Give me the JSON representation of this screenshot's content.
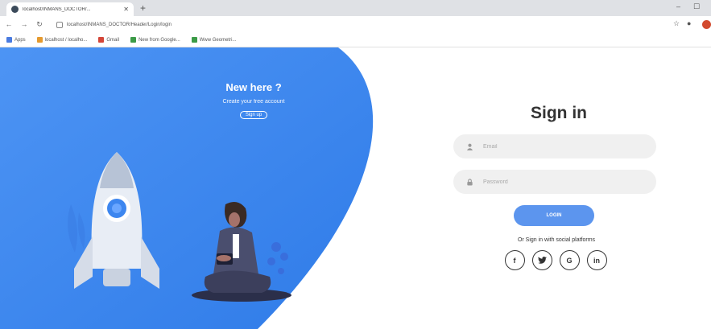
{
  "browser": {
    "tab_title": "localhost/INMANS_DOCTOR/...",
    "url": "localhost/INMANS_DOCTOR/Header/Login/login",
    "bookmarks": [
      "Apps",
      "localhost / localho...",
      "Gmail",
      "New from Google...",
      "Www Geometri..."
    ]
  },
  "promo": {
    "title": "New here ?",
    "subtitle": "Create your free account",
    "signup_label": "Sign up"
  },
  "signin": {
    "title": "Sign in",
    "email_placeholder": "Email",
    "password_placeholder": "Password",
    "login_label": "Login",
    "social_text": "Or Sign in with social platforms",
    "social_buttons": [
      {
        "icon": "facebook-icon",
        "glyph": "f"
      },
      {
        "icon": "twitter-icon",
        "glyph": "t"
      },
      {
        "icon": "google-icon",
        "glyph": "G"
      },
      {
        "icon": "linkedin-icon",
        "glyph": "in"
      }
    ]
  },
  "colors": {
    "accent_blue": "#3f87f0",
    "button_blue": "#5c95ee",
    "field_bg": "#f0f0f0"
  }
}
